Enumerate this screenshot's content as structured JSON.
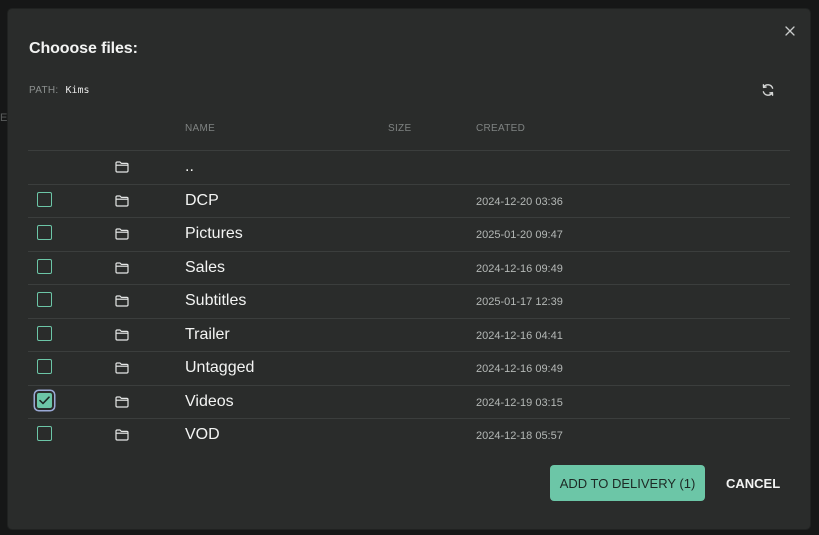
{
  "background": {
    "ghost_text": "E"
  },
  "dialog": {
    "title": "Chooose files:",
    "path_label": "PATH:",
    "path_value": "Kims"
  },
  "table": {
    "headers": {
      "name": "NAME",
      "size": "SIZE",
      "created": "CREATED"
    },
    "parent_row": {
      "name": ".."
    },
    "rows": [
      {
        "name": "DCP",
        "created": "2024-12-20 03:36",
        "checked": false
      },
      {
        "name": "Pictures",
        "created": "2025-01-20 09:47",
        "checked": false
      },
      {
        "name": "Sales",
        "created": "2024-12-16 09:49",
        "checked": false
      },
      {
        "name": "Subtitles",
        "created": "2025-01-17 12:39",
        "checked": false
      },
      {
        "name": "Trailer",
        "created": "2024-12-16 04:41",
        "checked": false
      },
      {
        "name": "Untagged",
        "created": "2024-12-16 09:49",
        "checked": false
      },
      {
        "name": "Videos",
        "created": "2024-12-19 03:15",
        "checked": true
      },
      {
        "name": "VOD",
        "created": "2024-12-18 05:57",
        "checked": false
      }
    ]
  },
  "footer": {
    "add_label": "ADD TO DELIVERY (1)",
    "cancel_label": "CANCEL"
  },
  "icons": {
    "close": "close-icon",
    "refresh": "refresh-icon",
    "folder": "folder-icon",
    "check": "checkmark-icon"
  },
  "colors": {
    "accent": "#6cc6a7",
    "modal_bg": "#2a2c2b",
    "focus_ring": "#9aa9d6"
  }
}
